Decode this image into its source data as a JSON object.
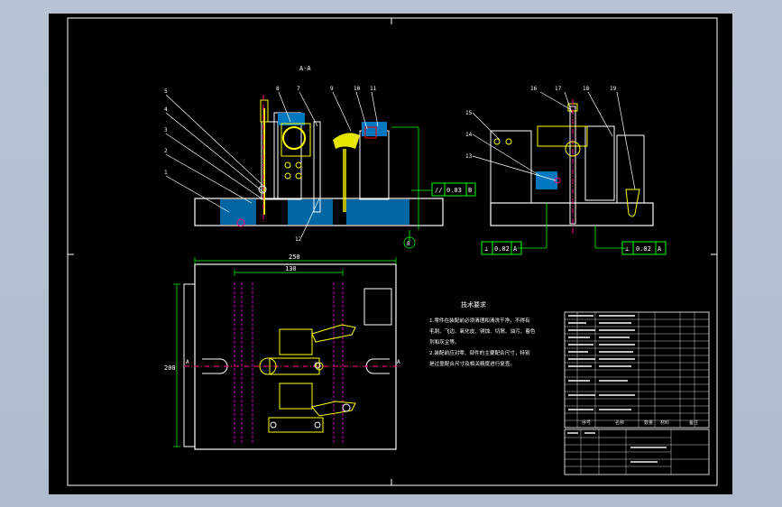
{
  "section_label": "A-A",
  "balloons_front": [
    "5",
    "4",
    "3",
    "2",
    "1",
    "8",
    "7",
    "9",
    "10",
    "11"
  ],
  "balloons_side": [
    "16",
    "17",
    "18",
    "19",
    "15",
    "14",
    "13"
  ],
  "balloon_front_bottom": "12",
  "datum_label": "B",
  "tolerances": {
    "parallel": {
      "symbol": "//",
      "value": "0.03",
      "datum": "B"
    },
    "perp_left": {
      "symbol": "⊥",
      "value": "0.02",
      "datum": "A"
    },
    "perp_right": {
      "symbol": "⊥",
      "value": "0.02",
      "datum": "A"
    }
  },
  "dimensions": {
    "overall_width": "250",
    "inner_width": "130",
    "height": "200"
  },
  "section_markers": {
    "left": "A",
    "right": "A"
  },
  "tech_req": {
    "title": "技术要求",
    "lines": [
      "1.零件在装配前必须清理和清洗干净，不得有",
      "毛刺、飞边、氧化皮、锈蚀、切屑、油污、着色",
      "剂和灰尘等。",
      "2.装配前应对零、部件的主要配合尺寸，特别",
      "是过盈配合尺寸及相关精度进行复查。"
    ]
  },
  "bom_header": [
    "序号",
    "名称",
    "数量",
    "材料",
    "备注"
  ],
  "colors": {
    "background": "#000000",
    "outline": "#ffffff",
    "part": "#ffff00",
    "section_fill": "#0080c0",
    "center_line": "#ff0080",
    "dimension": "#00ff00",
    "tolerance": "#00ff00",
    "hidden": "#ff00ff"
  }
}
